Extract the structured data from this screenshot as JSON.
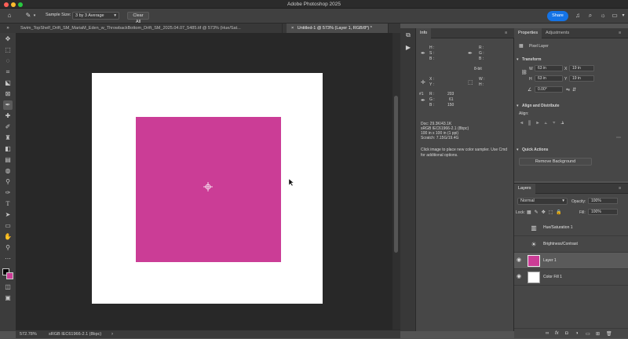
{
  "app": {
    "title": "Adobe Photoshop 2025"
  },
  "options_bar": {
    "sample_size_label": "Sample Size:",
    "sample_size_value": "3 by 3 Average",
    "clear_all": "Clear All",
    "share": "Share"
  },
  "tabs": [
    {
      "label": "Swim_TopShelf_Drift_SM_MariaM_Eden_w_ThrowbackBottom_Drift_SM_2025.04.07_5485.tif @ 573% (Hue/Sat...",
      "active": false
    },
    {
      "label": "Untitled-1 @ 573% (Layer 1, RGB/8*) *",
      "active": true
    }
  ],
  "canvas": {
    "layer_color": "#cb3d96",
    "background": "#ffffff"
  },
  "status": {
    "zoom": "572.78%",
    "profile": "sRGB IEC61966-2.1 (8bpc)"
  },
  "info_panel": {
    "title": "Info",
    "rgb_labels": [
      "R :",
      "G :",
      "B :"
    ],
    "hsb_labels": [
      "H :",
      "S :",
      "B :"
    ],
    "bit_depth": "8-bit",
    "x_label": "X :",
    "y_label": "Y :",
    "w_label": "W :",
    "h_label": "H :",
    "sample_id": "#1",
    "sample_r": "203",
    "sample_g": "61",
    "sample_b": "150",
    "doc": "Doc: 29.3K/43.1K",
    "profile": "sRGB IEC61966-2.1 (8bpc)",
    "dims": "100 in x 100 in (1 ppi)",
    "scratch": "Scratch: 7.15G/19.4G",
    "hint": "Click image to place new color sampler.  Use Cmd for additional options."
  },
  "properties": {
    "tab_properties": "Properties",
    "tab_adjustments": "Adjustments",
    "layer_type": "Pixel Layer",
    "transform": "Transform",
    "w_label": "W",
    "w_value": "63 in",
    "x_label": "X",
    "x_value": "19 in",
    "h_label": "H",
    "h_value": "63 in",
    "y_label": "Y",
    "y_value": "19 in",
    "angle": "0.00°",
    "align_distribute": "Align and Distribute",
    "align": "Align:",
    "quick_actions": "Quick Actions",
    "remove_bg": "Remove Background"
  },
  "layers": {
    "title": "Layers",
    "blend_mode": "Normal",
    "opacity_label": "Opacity:",
    "opacity": "100%",
    "lock_label": "Lock:",
    "fill_label": "Fill:",
    "fill": "100%",
    "items": [
      {
        "name": "Hue/Saturation 1",
        "visible": false,
        "selected": false,
        "icon": "hue-sat-icon"
      },
      {
        "name": "Brightness/Contrast",
        "visible": false,
        "selected": false,
        "icon": "brightness-icon"
      },
      {
        "name": "Layer 1",
        "visible": true,
        "selected": true,
        "icon": "pixel-thumb",
        "color": "#cb3d96"
      },
      {
        "name": "Color Fill 1",
        "visible": true,
        "selected": false,
        "icon": "fill-thumb",
        "color": "#ffffff"
      }
    ]
  }
}
